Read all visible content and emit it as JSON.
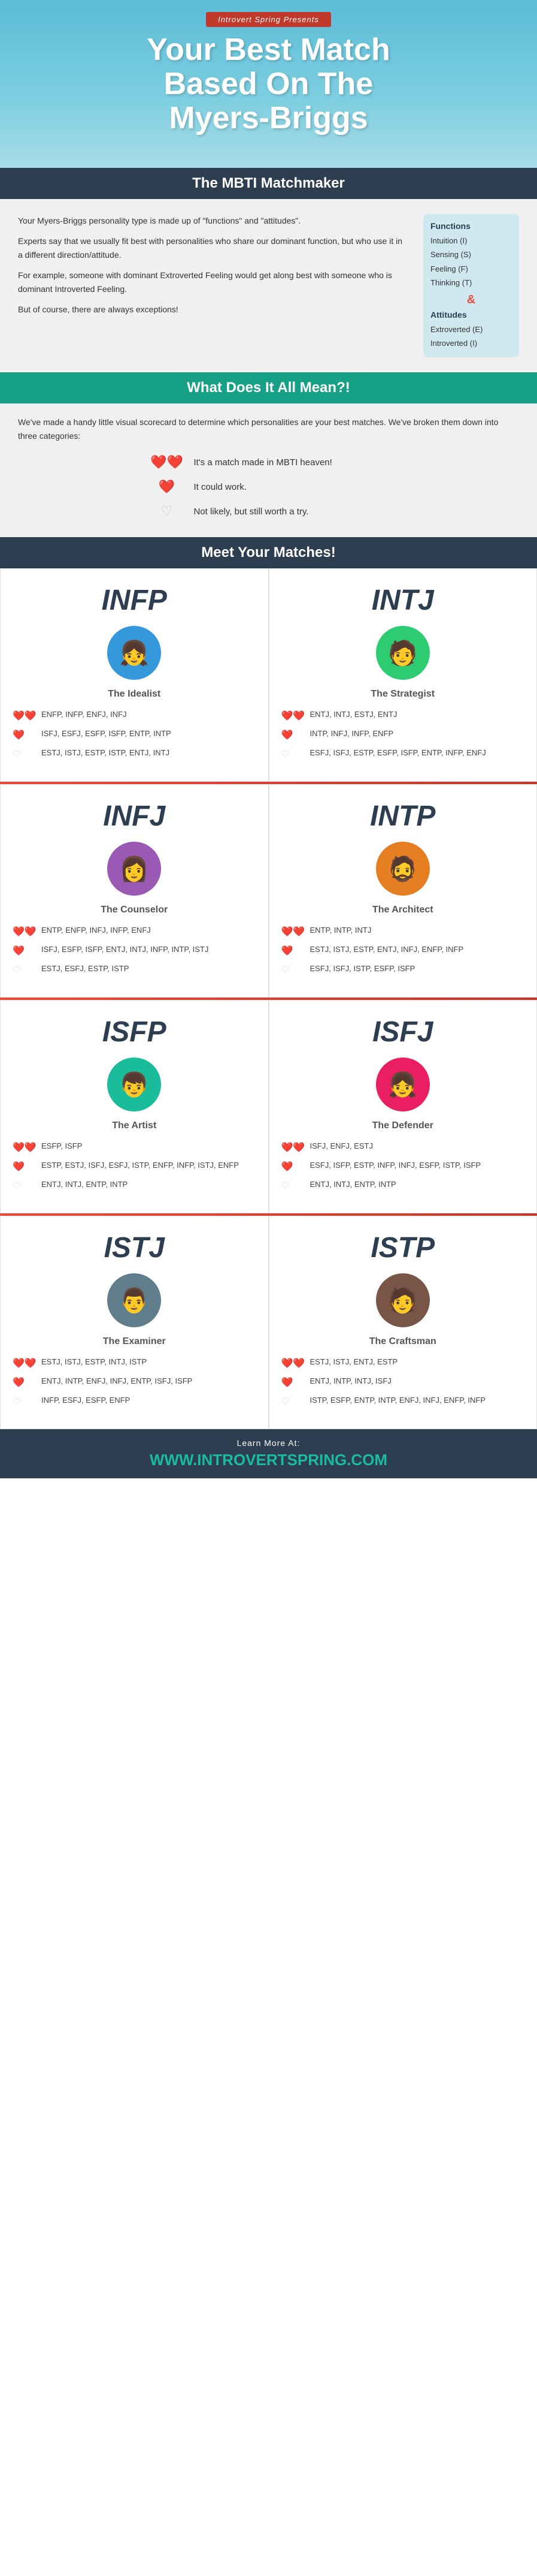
{
  "header": {
    "presents": "Introvert Spring Presents",
    "title_line1": "Your Best Match",
    "title_line2": "Based On The",
    "title_line3": "Myers-Briggs"
  },
  "matchmaker": {
    "section_title": "The MBTI Matchmaker",
    "para1": "Your Myers-Briggs personality type is made up of \"functions\" and \"attitudes\".",
    "para2": "Experts say that we usually fit best with personalities who share our dominant function, but who use it in a different direction/attitude.",
    "para3": "For example, someone with dominant Extroverted Feeling would get along best with someone who is dominant Introverted Feeling.",
    "para4": "But of course, there are always exceptions!",
    "sidebar": {
      "functions_title": "Functions",
      "intuition": "Intuition (I)",
      "sensing": "Sensing (S)",
      "feeling": "Feeling (F)",
      "thinking": "Thinking (T)",
      "ampersand": "&",
      "attitudes_title": "Attitudes",
      "extroverted": "Extroverted (E)",
      "introverted": "Introverted (I)"
    }
  },
  "meaning": {
    "section_title": "What Does It All Mean?!",
    "intro": "We've made a handy little visual scorecard to determine which personalities are your best matches. We've broken them down into three categories:",
    "legend": [
      {
        "hearts": "❤️❤️",
        "text": "It's a match made in MBTI heaven!"
      },
      {
        "hearts": "❤️",
        "text": "It could work."
      },
      {
        "hearts": "♡",
        "text": "Not likely, but still worth a try."
      }
    ]
  },
  "meet": {
    "section_title": "Meet Your Matches!",
    "personalities": [
      {
        "type": "INFP",
        "name": "The Idealist",
        "avatar_emoji": "👧",
        "avatar_color": "#3498db",
        "matches": [
          {
            "level": "high",
            "types": "ENFP, INFP, ENFJ, INFJ"
          },
          {
            "level": "mid",
            "types": "ISFJ, ESFJ, ESFP, ISFP, ENTP, INTP"
          },
          {
            "level": "low",
            "types": "ESTJ, ISTJ, ESTP, ISTP, ENTJ, INTJ"
          }
        ]
      },
      {
        "type": "INTJ",
        "name": "The Strategist",
        "avatar_emoji": "🧑",
        "avatar_color": "#2ecc71",
        "matches": [
          {
            "level": "high",
            "types": "ENTJ, INTJ, ESTJ, ENTJ"
          },
          {
            "level": "mid",
            "types": "INTP, INFJ, INFP, ENFP"
          },
          {
            "level": "low",
            "types": "ESFJ, ISFJ, ESTP, ESFP, ISFP, ENTP, INFP, ENFJ"
          }
        ]
      },
      {
        "type": "INFJ",
        "name": "The Counselor",
        "avatar_emoji": "👩",
        "avatar_color": "#9b59b6",
        "matches": [
          {
            "level": "high",
            "types": "ENTP, ENFP, INFJ, INFP, ENFJ"
          },
          {
            "level": "mid",
            "types": "ISFJ, ESFP, ISFP, ENTJ, INTJ, INFP, INTP, ISTJ"
          },
          {
            "level": "low",
            "types": "ESTJ, ESFJ, ESTP, ISTP"
          }
        ]
      },
      {
        "type": "INTP",
        "name": "The Architect",
        "avatar_emoji": "🧔",
        "avatar_color": "#e67e22",
        "matches": [
          {
            "level": "high",
            "types": "ENTP, INTP, INTJ"
          },
          {
            "level": "mid",
            "types": "ESTJ, ISTJ, ESTP, ENTJ, INFJ, ENFP, INFP"
          },
          {
            "level": "low",
            "types": "ESFJ, ISFJ, ISTP, ESFP, ISFP"
          }
        ]
      },
      {
        "type": "ISFP",
        "name": "The Artist",
        "avatar_emoji": "👦",
        "avatar_color": "#1abc9c",
        "matches": [
          {
            "level": "high",
            "types": "ESFP, ISFP"
          },
          {
            "level": "mid",
            "types": "ESTP, ESTJ, ISFJ, ESFJ, ISTP, ENFP, INFP, ISTJ, ENFP"
          },
          {
            "level": "low",
            "types": "ENTJ, INTJ, ENTP, INTP"
          }
        ]
      },
      {
        "type": "ISFJ",
        "name": "The Defender",
        "avatar_emoji": "👧",
        "avatar_color": "#e91e63",
        "matches": [
          {
            "level": "high",
            "types": "ISFJ, ENFJ, ESTJ"
          },
          {
            "level": "mid",
            "types": "ESFJ, ISFP, ESTP, INFP, INFJ, ESFP, ISTP, ISFP"
          },
          {
            "level": "low",
            "types": "ENTJ, INTJ, ENTP, INTP"
          }
        ]
      },
      {
        "type": "ISTJ",
        "name": "The Examiner",
        "avatar_emoji": "👨",
        "avatar_color": "#607d8b",
        "matches": [
          {
            "level": "high",
            "types": "ESTJ, ISTJ, ESTP, INTJ, ISTP"
          },
          {
            "level": "mid",
            "types": "ENTJ, INTP, ENFJ, INFJ, ENTP, ISFJ, ISFP"
          },
          {
            "level": "low",
            "types": "INFP, ESFJ, ESFP, ENFP"
          }
        ]
      },
      {
        "type": "ISTP",
        "name": "The Craftsman",
        "avatar_emoji": "🧑",
        "avatar_color": "#795548",
        "matches": [
          {
            "level": "high",
            "types": "ESTJ, ISTJ, ENTJ, ESTP"
          },
          {
            "level": "mid",
            "types": "ENTJ, INTP, INTJ, ISFJ"
          },
          {
            "level": "low",
            "types": "ISTP, ESFP, ENTP, INTP, ENFJ, INFJ, ENFP, INFP"
          }
        ]
      }
    ]
  },
  "footer": {
    "learn_more": "Learn More At:",
    "url": "WWW.INTROVERTSPRING.COM"
  }
}
